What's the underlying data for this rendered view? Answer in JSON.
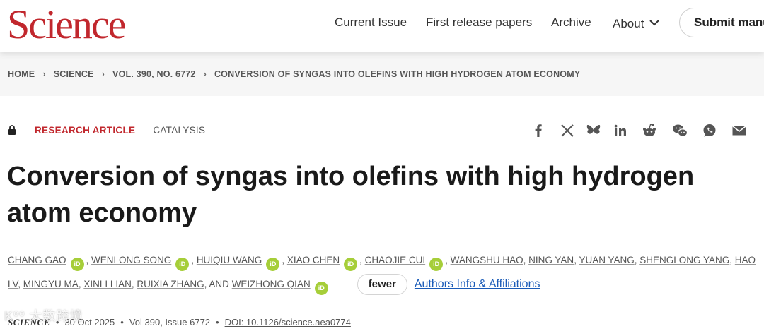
{
  "header": {
    "logo": "Science",
    "nav": [
      "Current Issue",
      "First release papers",
      "Archive",
      "About"
    ],
    "submit_label": "Submit manus"
  },
  "breadcrumb": [
    "HOME",
    "SCIENCE",
    "VOL. 390, NO. 6772",
    "CONVERSION OF SYNGAS INTO OLEFINS WITH HIGH HYDROGEN ATOM ECONOMY"
  ],
  "article": {
    "type": "RESEARCH ARTICLE",
    "subject": "CATALYSIS",
    "title": "Conversion of syngas into olefins with high hydrogen atom economy",
    "authors": [
      {
        "name": "CHANG GAO",
        "orcid": true
      },
      {
        "name": "WENLONG SONG",
        "orcid": true
      },
      {
        "name": "HUIQIU WANG",
        "orcid": true
      },
      {
        "name": "XIAO CHEN",
        "orcid": true
      },
      {
        "name": "CHAOJIE CUI",
        "orcid": true
      },
      {
        "name": "WANGSHU HAO",
        "orcid": false
      },
      {
        "name": "NING YAN",
        "orcid": false
      },
      {
        "name": "YUAN YANG",
        "orcid": false
      },
      {
        "name": "SHENGLONG YANG",
        "orcid": false
      },
      {
        "name": "HAO LV",
        "orcid": false
      },
      {
        "name": "MINGYU MA",
        "orcid": false
      },
      {
        "name": "XINLI LIAN",
        "orcid": false
      },
      {
        "name": "RUIXIA ZHANG",
        "orcid": false
      },
      {
        "name": "WEIZHONG QIAN",
        "orcid": true
      }
    ],
    "and_word": "AND",
    "orcid_label": "iD",
    "fewer_label": "fewer",
    "affiliations_label": "Authors Info & Affiliations"
  },
  "citation": {
    "journal": "SCIENCE",
    "date": "30 Oct 2025",
    "volume": "Vol 390, Issue 6772",
    "doi": "DOI: 10.1126/science.aea0774"
  },
  "share_icons": [
    "facebook-icon",
    "x-icon",
    "bluesky-icon",
    "linkedin-icon",
    "reddit-icon",
    "wechat-icon",
    "whatsapp-icon",
    "email-icon"
  ],
  "watermark": "K⁰⁰ 大数跨境",
  "colors": {
    "brand": "#c1272d",
    "link": "#1a5bb8",
    "orcid": "#a6ce39"
  }
}
